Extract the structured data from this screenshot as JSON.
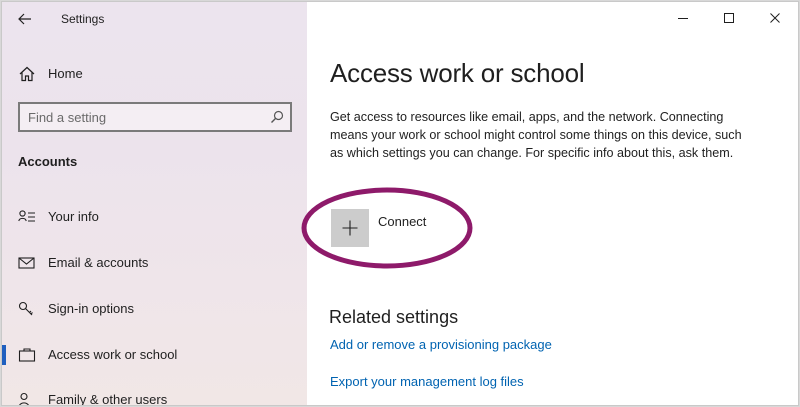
{
  "window": {
    "title": "Settings"
  },
  "sidebar": {
    "home_label": "Home",
    "search_placeholder": "Find a setting",
    "section_title": "Accounts",
    "items": [
      {
        "label": "Your info",
        "icon": "person-info-icon",
        "active": false
      },
      {
        "label": "Email & accounts",
        "icon": "envelope-icon",
        "active": false
      },
      {
        "label": "Sign-in options",
        "icon": "key-icon",
        "active": false
      },
      {
        "label": "Access work or school",
        "icon": "briefcase-icon",
        "active": true
      },
      {
        "label": "Family & other users",
        "icon": "person-add-icon",
        "active": false
      }
    ]
  },
  "main": {
    "title": "Access work or school",
    "description": "Get access to resources like email, apps, and the network. Connecting means your work or school might control some things on this device, such as which settings you can change. For specific info about this, ask them.",
    "connect_label": "Connect",
    "related_title": "Related settings",
    "links": [
      "Add or remove a provisioning package",
      "Export your management log files"
    ]
  },
  "colors": {
    "accent": "#1f5fbf",
    "link": "#0063b1",
    "highlight": "#8e1a6a",
    "tile": "#cccccc"
  }
}
